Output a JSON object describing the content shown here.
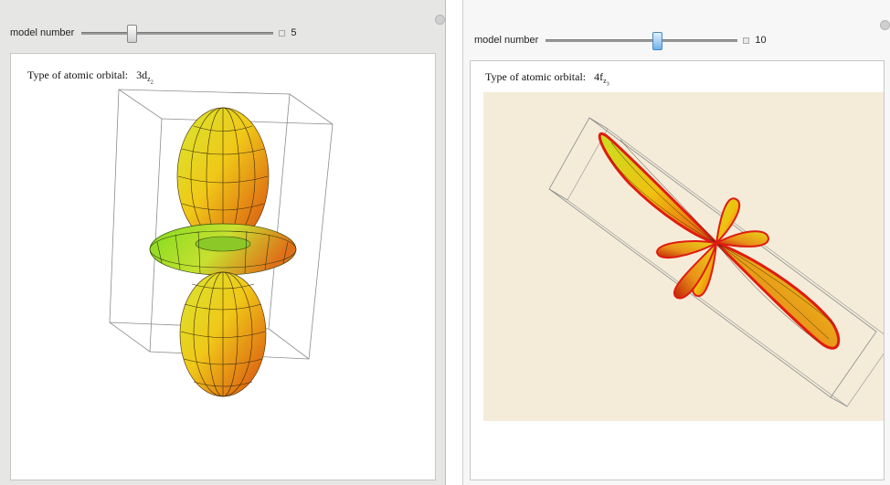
{
  "left": {
    "control": {
      "label": "model number",
      "value": "5"
    },
    "orbital": {
      "label": "Type of atomic orbital:",
      "name": "3d",
      "subscript": "z",
      "superscript_sub": "2"
    }
  },
  "right": {
    "control": {
      "label": "model number",
      "value": "10"
    },
    "orbital": {
      "label": "Type of atomic orbital:",
      "name": "4f",
      "subscript": "z",
      "superscript_sub": "3"
    }
  },
  "icons": {
    "corner": "plus-circle-icon",
    "increment": "plus-box-icon"
  },
  "colors": {
    "orbital_edge": "#e01b10",
    "plot_bg_right": "#f4ecd9",
    "box_lines": "#8c8c8c"
  }
}
